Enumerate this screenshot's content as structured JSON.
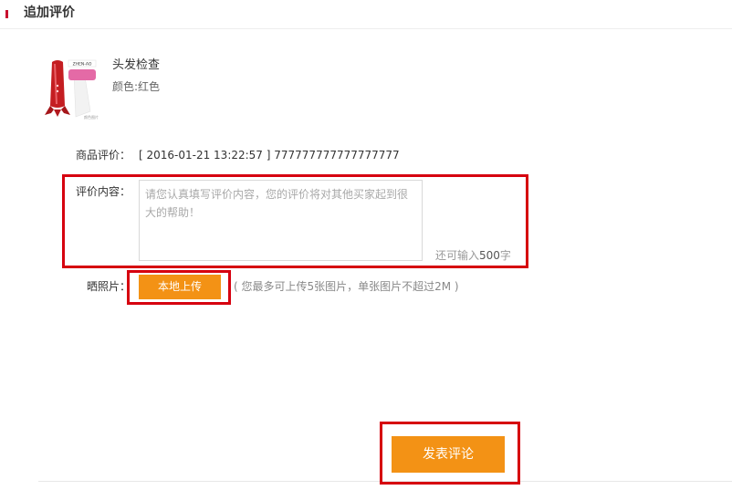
{
  "header": {
    "title": "追加评价",
    "accent_color": "#c8102e"
  },
  "product": {
    "name": "头发检查",
    "attribute": "颜色:红色",
    "thumbnail_icon": "product-thumbnail",
    "thumbnail_text": {
      "brand": "ZHEN-AO",
      "caption": "颜色图片"
    }
  },
  "rating": {
    "label": "商品评价：",
    "value": "[ 2016-01-21 13:22:57 ] 777777777777777777"
  },
  "review": {
    "label": "评价内容：",
    "value": "",
    "placeholder": "请您认真填写评价内容，您的评价将对其他买家起到很大的帮助！",
    "remaining_prefix": "还可输入",
    "remaining_count": "500",
    "remaining_suffix": "字"
  },
  "photos": {
    "label": "晒照片：",
    "upload_label": "本地上传",
    "hint": "( 您最多可上传5张图片，单张图片不超过2M )"
  },
  "submit": {
    "label": "发表评论"
  },
  "colors": {
    "button_orange": "#f39215",
    "highlight_red": "#d6000f"
  }
}
